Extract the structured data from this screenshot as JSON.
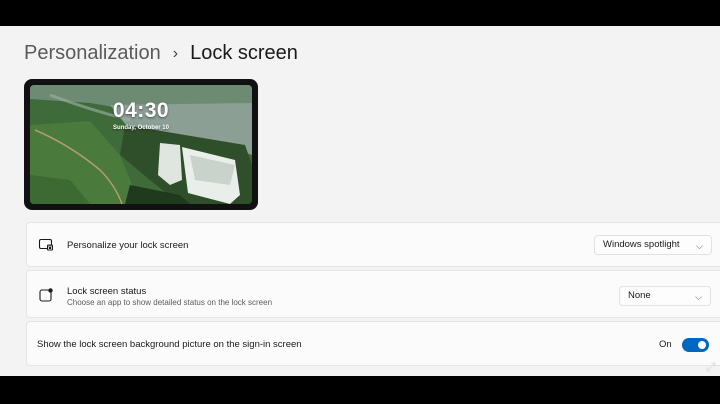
{
  "breadcrumb": {
    "parent": "Personalization",
    "separator": "›",
    "current": "Lock screen"
  },
  "preview": {
    "time": "04:30",
    "date": "Sunday, October 10"
  },
  "settings": {
    "personalize": {
      "title": "Personalize your lock screen",
      "value": "Windows spotlight",
      "icon": "lock-screen-monitor-icon"
    },
    "status": {
      "title": "Lock screen status",
      "subtitle": "Choose an app to show detailed status on the lock screen",
      "value": "None",
      "icon": "status-app-icon"
    },
    "signin_bg": {
      "title": "Show the lock screen background picture on the sign-in screen",
      "state_label": "On",
      "enabled": true
    }
  },
  "colors": {
    "accent": "#0067c0",
    "window_bg": "#f3f3f3",
    "card_bg": "#fbfbfb"
  }
}
